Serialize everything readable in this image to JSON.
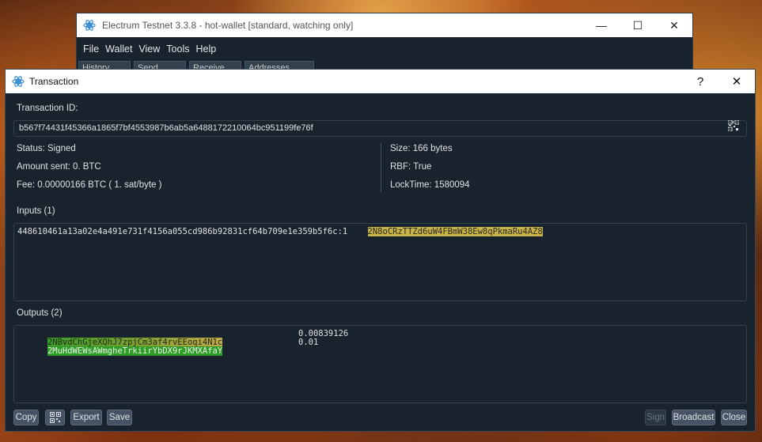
{
  "main_window": {
    "title": "Electrum Testnet 3.3.8  -  hot-wallet  [standard, watching only]",
    "menu": [
      "File",
      "Wallet",
      "View",
      "Tools",
      "Help"
    ],
    "tabs": [
      "History",
      "Send",
      "Receive",
      "Addresses"
    ]
  },
  "dialog": {
    "title": "Transaction",
    "help_label": "?",
    "close_label": "✕",
    "txid_label": "Transaction ID:",
    "txid": "b567f74431f45366a1865f7bf4553987b6ab5a6488172210064bc951199fe76f",
    "status": "Status: Signed",
    "amount_sent": "Amount sent: 0. BTC",
    "fee": "Fee: 0.00000166 BTC  ( 1. sat/byte )",
    "size": "Size: 166 bytes",
    "rbf": "RBF: True",
    "locktime": "LockTime: 1580094",
    "inputs_label": "Inputs (1)",
    "inputs": [
      {
        "outpoint": "448610461a13a02e4a491e731f4156a055cd986b92831cf64b709e1e359b5f6c:1",
        "address": "2N8oCRzTTZd6uW4FBmW38Ew8qPkmaRu4AZ8"
      }
    ],
    "outputs_label": "Outputs (2)",
    "outputs": [
      {
        "address": "2NBvdChGjeXQhJ7zpjCm3af4rvEEoqi4N1c",
        "amount": "0.00839126"
      },
      {
        "address": "2MuHdWEWsAWmgheTrkiirYbDX9rJKMXAfaY",
        "amount": "0.01"
      }
    ],
    "buttons": {
      "copy": "Copy",
      "export": "Export",
      "save": "Save",
      "sign": "Sign",
      "broadcast": "Broadcast",
      "close": "Close"
    }
  },
  "colors": {
    "dialog_bg": "#19232d",
    "address_yellow": "#c9b44a",
    "address_green": "#2f9c28",
    "button_bg": "#455364"
  }
}
